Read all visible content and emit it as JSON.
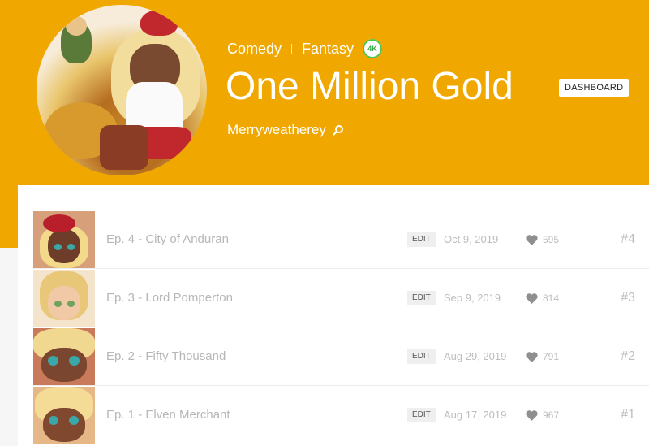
{
  "series": {
    "genres": [
      "Comedy",
      "Fantasy"
    ],
    "quality_badge": "4K",
    "title": "One Million Gold",
    "dashboard_label": "DASHBOARD",
    "author": "Merryweatherey"
  },
  "colors": {
    "accent": "#f0a800",
    "badge_green": "#35a845"
  },
  "episodes": [
    {
      "title": "Ep. 4 - City of Anduran",
      "edit_label": "EDIT",
      "date": "Oct 9, 2019",
      "likes": "595",
      "number": "#4"
    },
    {
      "title": "Ep. 3 - Lord Pomperton",
      "edit_label": "EDIT",
      "date": "Sep 9, 2019",
      "likes": "814",
      "number": "#3"
    },
    {
      "title": "Ep. 2 - Fifty Thousand",
      "edit_label": "EDIT",
      "date": "Aug 29, 2019",
      "likes": "791",
      "number": "#2"
    },
    {
      "title": "Ep. 1 - Elven Merchant",
      "edit_label": "EDIT",
      "date": "Aug 17, 2019",
      "likes": "967",
      "number": "#1"
    }
  ]
}
